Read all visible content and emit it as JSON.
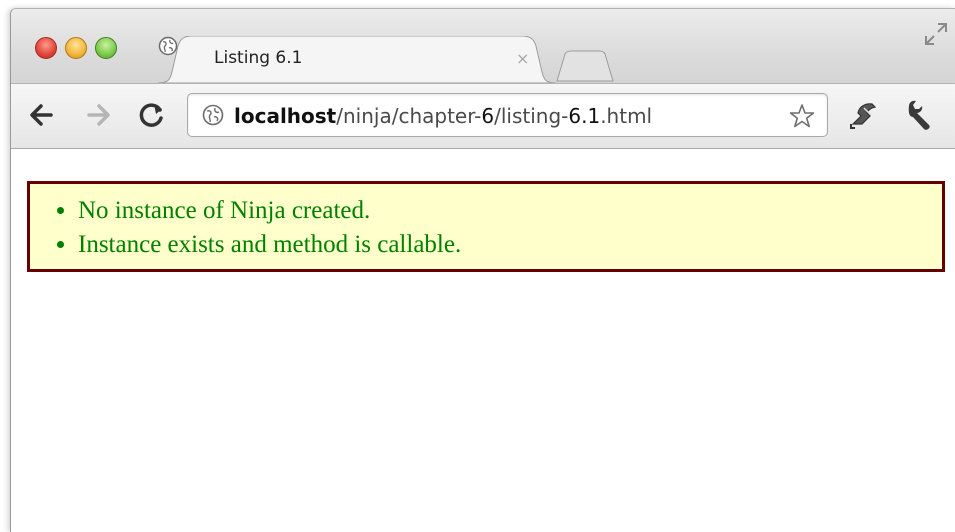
{
  "tab": {
    "title": "Listing 6.1",
    "close_glyph": "×"
  },
  "omnibox": {
    "host": "localhost",
    "path_prefix": "/ninja/chapter-",
    "chapter": "6",
    "path_mid": "/listing-",
    "file_num": "6.1",
    "path_suffix": ".html"
  },
  "icons": {
    "tab_favicon": "globe-icon",
    "omni_site": "globe-icon",
    "back": "back-arrow-icon",
    "forward": "forward-arrow-icon",
    "reload": "reload-icon",
    "bookmark": "star-icon",
    "extension": "extension-icon",
    "menu": "wrench-icon",
    "fullscreen": "expand-icon"
  },
  "results": {
    "items": [
      "No instance of Ninja created.",
      "Instance exists and method is callable."
    ]
  },
  "colors": {
    "results_background": "#ffffcc",
    "results_border": "#660000",
    "results_text": "#008000"
  }
}
